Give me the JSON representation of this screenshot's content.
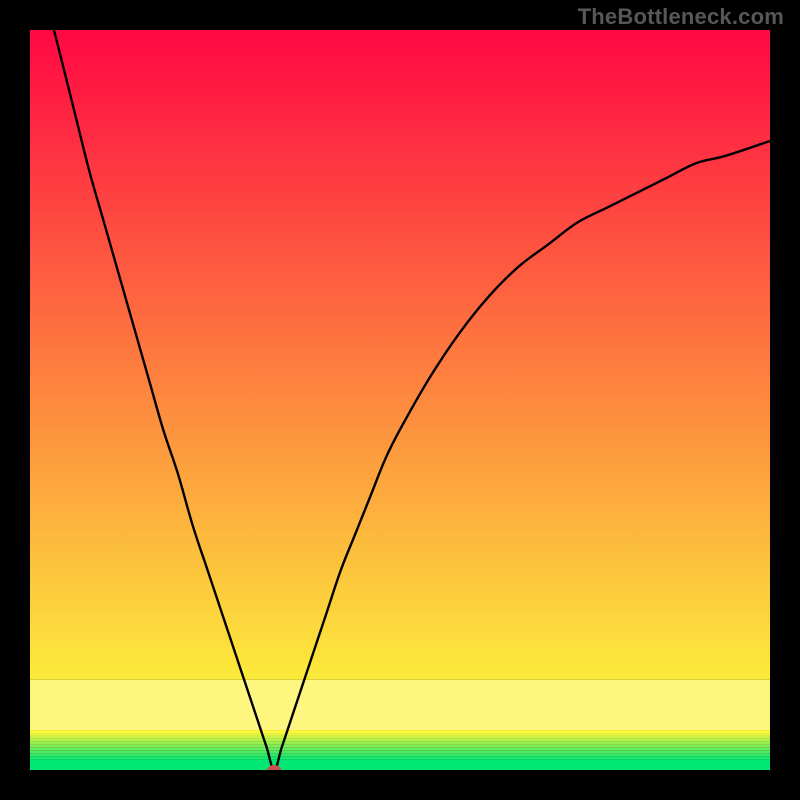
{
  "watermark": "TheBottleneck.com",
  "chart_data": {
    "type": "line",
    "title": "",
    "xlabel": "",
    "ylabel": "",
    "xlim": [
      0,
      100
    ],
    "ylim": [
      0,
      100
    ],
    "grid": false,
    "legend": false,
    "marker": {
      "x": 33,
      "y": 0,
      "color": "#cb514f"
    },
    "series": [
      {
        "name": "curve",
        "x": [
          0,
          2,
          4,
          6,
          8,
          10,
          12,
          14,
          16,
          18,
          20,
          22,
          24,
          26,
          28,
          30,
          31,
          32,
          33,
          34,
          35,
          36,
          38,
          40,
          42,
          44,
          46,
          48,
          50,
          54,
          58,
          62,
          66,
          70,
          74,
          78,
          82,
          86,
          90,
          94,
          100
        ],
        "y": [
          115,
          105,
          97,
          89,
          81,
          74,
          67,
          60,
          53,
          46,
          40,
          33,
          27,
          21,
          15,
          9,
          6,
          3,
          0,
          3,
          6,
          9,
          15,
          21,
          27,
          32,
          37,
          42,
          46,
          53,
          59,
          64,
          68,
          71,
          74,
          76,
          78,
          80,
          82,
          83,
          85
        ],
        "color": "#000000"
      }
    ],
    "gradient_bands": [
      {
        "y0": 0.0,
        "y1": 0.014,
        "color": "#00e774"
      },
      {
        "y0": 0.014,
        "y1": 0.018,
        "color": "#17e86e"
      },
      {
        "y0": 0.018,
        "y1": 0.022,
        "color": "#30ea68"
      },
      {
        "y0": 0.022,
        "y1": 0.026,
        "color": "#4aeb63"
      },
      {
        "y0": 0.026,
        "y1": 0.03,
        "color": "#63ed5d"
      },
      {
        "y0": 0.03,
        "y1": 0.034,
        "color": "#7dee57"
      },
      {
        "y0": 0.034,
        "y1": 0.038,
        "color": "#96f051"
      },
      {
        "y0": 0.038,
        "y1": 0.042,
        "color": "#b0f14c"
      },
      {
        "y0": 0.042,
        "y1": 0.046,
        "color": "#c9f346"
      },
      {
        "y0": 0.046,
        "y1": 0.05,
        "color": "#e3f440"
      },
      {
        "y0": 0.05,
        "y1": 0.054,
        "color": "#fdf63b"
      },
      {
        "y0": 0.054,
        "y1": 0.122,
        "color": "#fff680"
      },
      {
        "y0": 0.122,
        "y1": 1.0,
        "color_top": "#ff0743",
        "color_bottom": "#fceb3b"
      }
    ]
  }
}
